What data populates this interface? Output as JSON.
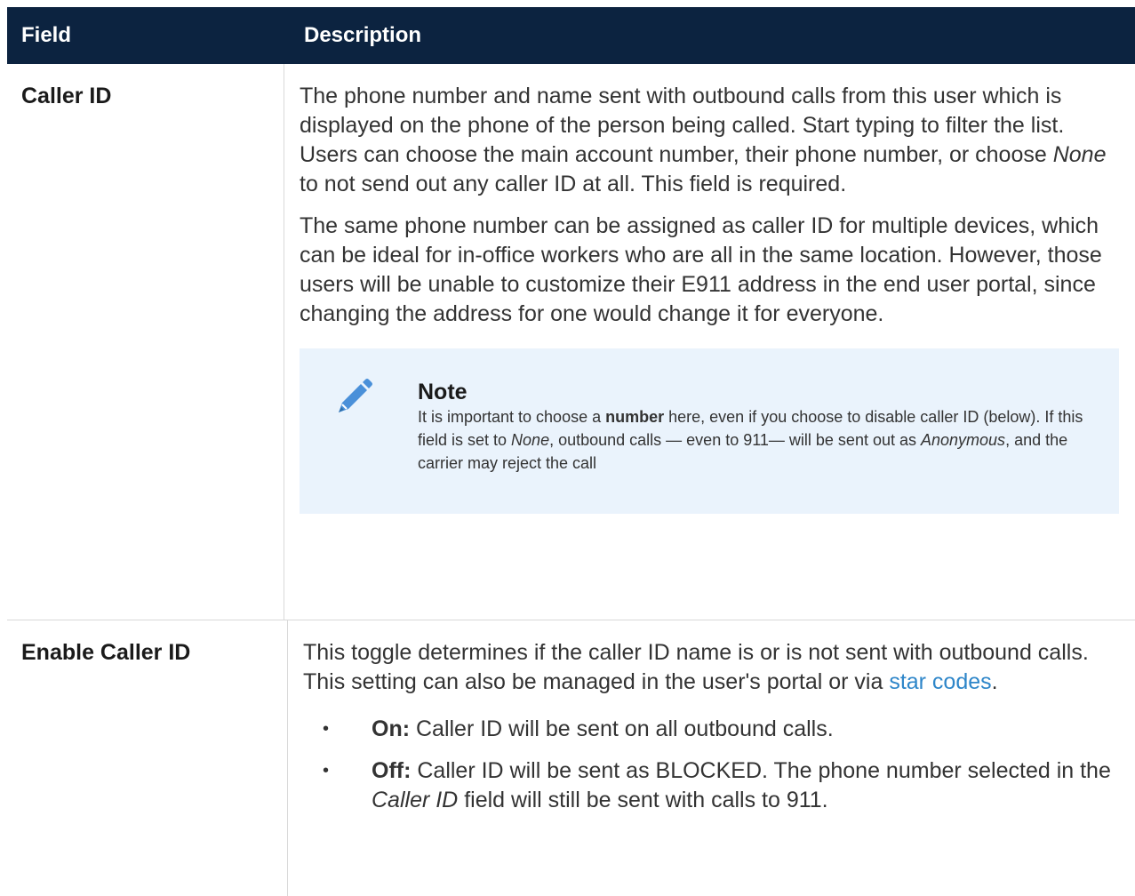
{
  "header": {
    "field_col": "Field",
    "desc_col": "Description"
  },
  "rows": [
    {
      "field": "Caller ID",
      "p1": {
        "a": "The phone number and name sent with outbound calls from this user which is displayed on the phone of the person being called. Start typing to filter the list. Users can choose the main account number, their phone number, or choose ",
        "em": "None",
        "b": " to not send out any caller ID at all. This field is required."
      },
      "p2": "The same phone number can be assigned as caller ID for multiple devices, which can be ideal for in-office workers who are all in the same location. However, those users will be unable to customize their E911 address in the end user portal, since changing the address for one would change it for everyone.",
      "note": {
        "icon": "pencil-icon",
        "title": "Note",
        "t1": "It is important to choose a ",
        "strong": "number",
        "t2": " here, even if you choose to disable caller ID (below). If this field is set to ",
        "em1": "None",
        "t3": ", outbound calls — even to 911— will be sent out as ",
        "em2": "Anonymous",
        "t4": ", and the carrier may reject the call"
      }
    },
    {
      "field": "Enable Caller ID",
      "p1": "This toggle determines if the caller ID name is or is not sent with outbound calls. This setting can also be managed in the user's portal or via ",
      "link": "star codes",
      "p1_end": ".",
      "bullets": [
        {
          "bold": "On:",
          "text": " Caller ID will be sent on all outbound calls."
        },
        {
          "bold": "Off:",
          "text_a": " Caller ID will be sent as BLOCKED. The phone number selected in the ",
          "em": "Caller ID",
          "text_b": " field will still be sent with calls to 911."
        }
      ]
    }
  ],
  "colors": {
    "header_bg": "#0c2340",
    "note_bg": "#eaf3fc",
    "link": "#2e86c9",
    "icon": "#4a90d9"
  }
}
